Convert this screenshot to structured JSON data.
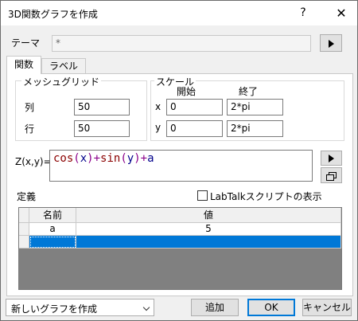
{
  "window": {
    "title": "3D関数グラフを作成",
    "help": "?",
    "close": "✕"
  },
  "theme": {
    "label": "テーマ",
    "value": "*"
  },
  "tabs": [
    {
      "label": "関数",
      "active": true
    },
    {
      "label": "ラベル",
      "active": false
    }
  ],
  "mesh": {
    "title": "メッシュグリッド",
    "col_label": "列",
    "col_value": "50",
    "row_label": "行",
    "row_value": "50"
  },
  "scale": {
    "title": "スケール",
    "start_header": "開始",
    "end_header": "終了",
    "x_label": "x",
    "x_start": "0",
    "x_end": "2*pi",
    "y_label": "y",
    "y_start": "0",
    "y_end": "2*pi"
  },
  "formula": {
    "label": "Z(x,y)=",
    "tokens": [
      {
        "text": "cos",
        "kind": "fn"
      },
      {
        "text": "(",
        "kind": "op"
      },
      {
        "text": "x",
        "kind": "var"
      },
      {
        "text": ")",
        "kind": "op"
      },
      {
        "text": "+",
        "kind": "op"
      },
      {
        "text": "sin",
        "kind": "fn"
      },
      {
        "text": "(",
        "kind": "op"
      },
      {
        "text": "y",
        "kind": "var"
      },
      {
        "text": ")",
        "kind": "op"
      },
      {
        "text": "+",
        "kind": "op"
      },
      {
        "text": "a",
        "kind": "var"
      }
    ]
  },
  "definitions": {
    "label": "定義",
    "labtalk_label": "LabTalkスクリプトの表示",
    "labtalk_checked": false,
    "columns": [
      "名前",
      "値"
    ],
    "rows": [
      {
        "name": "a",
        "value": "5"
      }
    ]
  },
  "footer": {
    "select_value": "新しいグラフを作成",
    "add_label": "追加",
    "ok_label": "OK",
    "cancel_label": "キャンセル"
  },
  "colors": {
    "selection": "#0078d7",
    "function": "#8b0000",
    "variable": "#00008b",
    "operator": "#8b008b"
  }
}
